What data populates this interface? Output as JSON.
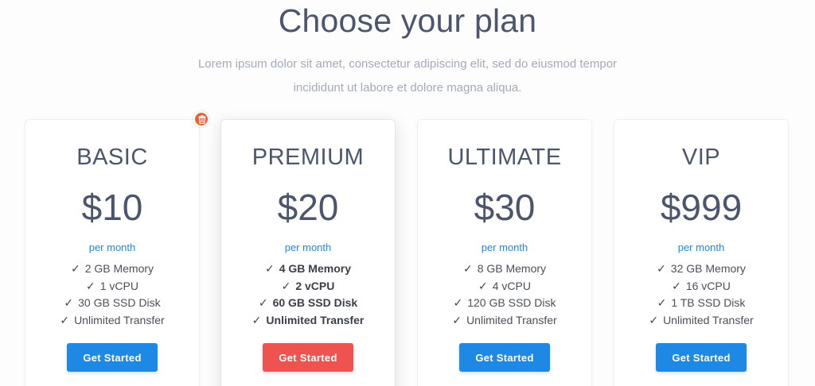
{
  "header": {
    "title": "Choose your plan",
    "subtitle": "Lorem ipsum dolor sit amet, consectetur adipiscing elit, sed do eiusmod tempor incididunt ut labore et dolore magna aliqua."
  },
  "plans": [
    {
      "name": "BASIC",
      "price": "$10",
      "period": "per month",
      "features": [
        "2 GB Memory",
        "1 vCPU",
        "30 GB SSD Disk",
        "Unlimited Transfer"
      ],
      "button": "Get Started"
    },
    {
      "name": "PREMIUM",
      "price": "$20",
      "period": "per month",
      "features": [
        "4 GB Memory",
        "2 vCPU",
        "60 GB SSD Disk",
        "Unlimited Transfer"
      ],
      "button": "Get Started"
    },
    {
      "name": "ULTIMATE",
      "price": "$30",
      "period": "per month",
      "features": [
        "8 GB Memory",
        "4 vCPU",
        "120 GB SSD Disk",
        "Unlimited Transfer"
      ],
      "button": "Get Started"
    },
    {
      "name": "VIP",
      "price": "$999",
      "period": "per month",
      "features": [
        "32 GB Memory",
        "16 vCPU",
        "1 TB SSD Disk",
        "Unlimited Transfer"
      ],
      "button": "Get Started"
    }
  ],
  "icons": {
    "check": "check-icon",
    "delete": "trash-icon"
  },
  "colors": {
    "primary_button": "#1e88e5",
    "featured_button": "#ef5350",
    "period_text": "#1e88e5",
    "heading_text": "#4b566d",
    "delete_badge": "#e8613a"
  }
}
